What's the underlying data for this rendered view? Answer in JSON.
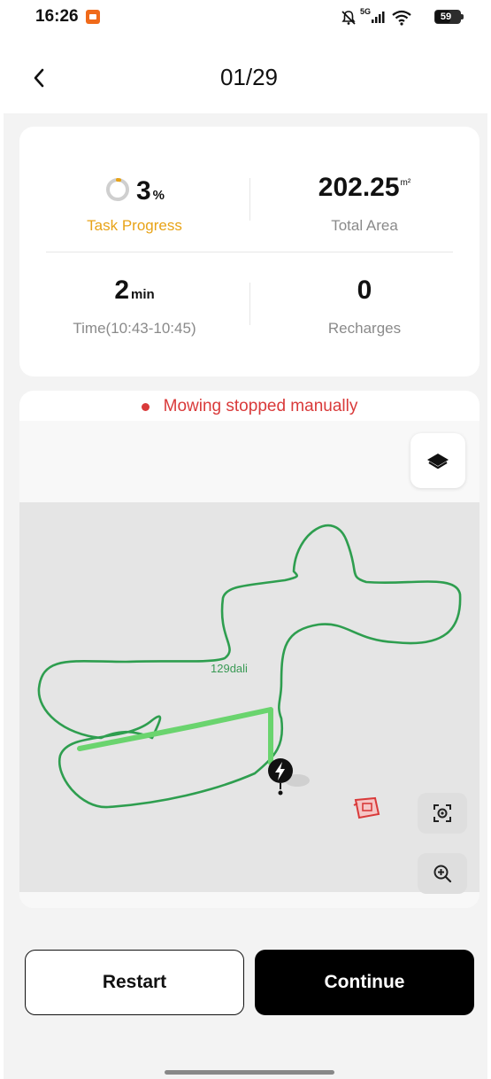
{
  "status_bar": {
    "time": "16:26",
    "network": "5G",
    "battery": "59"
  },
  "header": {
    "title": "01/29",
    "back_icon": "chevron-left-icon"
  },
  "stats": {
    "progress": {
      "value": "3",
      "unit": "%",
      "label": "Task Progress",
      "fraction": 0.03
    },
    "area": {
      "value": "202.25",
      "unit": "m²",
      "label": "Total Area"
    },
    "time": {
      "value": "2",
      "unit": "min",
      "label": "Time(10:43-10:45)"
    },
    "recharges": {
      "value": "0",
      "label": "Recharges"
    }
  },
  "map": {
    "status_message": "Mowing stopped manually",
    "zone_label": "129dali",
    "layers_icon": "layers-icon",
    "recenter_icon": "recenter-icon",
    "zoom_icon": "zoom-in-icon"
  },
  "colors": {
    "accent_orange": "#e8a317",
    "alert_red": "#d93a3a",
    "boundary_green": "#2e9e4f",
    "mowed_path_green": "#6ad46e"
  },
  "actions": {
    "restart": "Restart",
    "continue": "Continue"
  }
}
